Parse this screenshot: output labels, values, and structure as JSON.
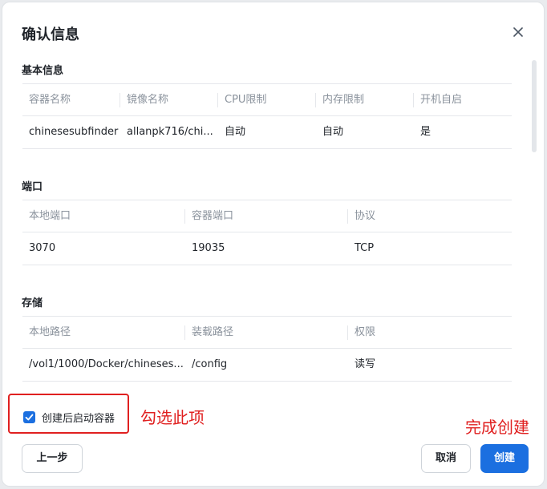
{
  "dialog": {
    "title": "确认信息",
    "close_icon": "close-icon"
  },
  "basic": {
    "title": "基本信息",
    "headers": [
      "容器名称",
      "镜像名称",
      "CPU限制",
      "内存限制",
      "开机自启"
    ],
    "row": [
      "chinesesubfinder",
      "allanpk716/chi...",
      "自动",
      "自动",
      "是"
    ]
  },
  "ports": {
    "title": "端口",
    "headers": [
      "本地端口",
      "容器端口",
      "协议"
    ],
    "row": [
      "3070",
      "19035",
      "TCP"
    ]
  },
  "storage": {
    "title": "存储",
    "headers": [
      "本地路径",
      "装载路径",
      "权限"
    ],
    "row": [
      "/vol1/1000/Docker/chineses...",
      "/config",
      "读写"
    ]
  },
  "footer": {
    "checkbox_label": "创建后启动容器",
    "checkbox_checked": true,
    "prev_label": "上一步",
    "cancel_label": "取消",
    "create_label": "创建"
  },
  "annotations": {
    "check_hint": "勾选此项",
    "create_hint": "完成创建"
  },
  "colors": {
    "primary": "#1b6fe0",
    "annotation": "#e02020"
  }
}
